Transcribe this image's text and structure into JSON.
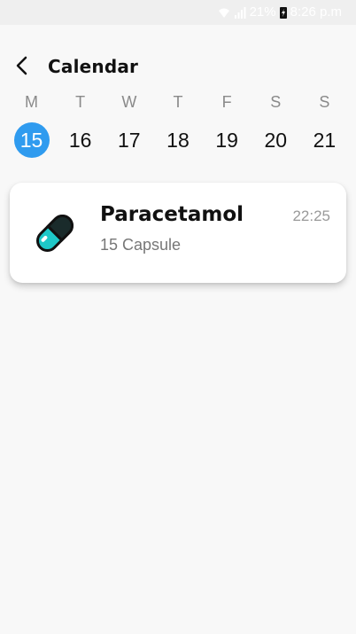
{
  "status_bar": {
    "battery": "21%",
    "time": "8:26 p.m",
    "icons": [
      "wifi-icon",
      "signal-icon",
      "charging-icon"
    ]
  },
  "header": {
    "back_icon": "chevron-left-icon",
    "title": "Calendar"
  },
  "week": {
    "days": [
      {
        "letter": "M",
        "number": "15",
        "selected": true
      },
      {
        "letter": "T",
        "number": "16",
        "selected": false
      },
      {
        "letter": "W",
        "number": "17",
        "selected": false
      },
      {
        "letter": "T",
        "number": "18",
        "selected": false
      },
      {
        "letter": "F",
        "number": "19",
        "selected": false
      },
      {
        "letter": "S",
        "number": "20",
        "selected": false
      },
      {
        "letter": "S",
        "number": "21",
        "selected": false
      }
    ],
    "selected_color": "#2f9bef"
  },
  "medications": [
    {
      "name": "Paracetamol",
      "dose": "15 Capsule",
      "time": "22:25",
      "icon": "capsule-icon",
      "icon_color": "#1ec8c8"
    }
  ]
}
